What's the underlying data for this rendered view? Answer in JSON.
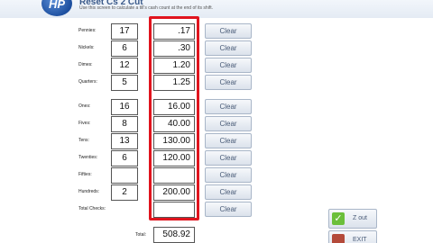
{
  "header": {
    "logo_text": "HP",
    "title": "Reset Cs 2 Cut",
    "subtitle": "Use this screen to calculate a till's cash count at the end of its shift."
  },
  "rows": [
    {
      "label": "Pennies:",
      "count": "17",
      "amount": ".17",
      "clear": "Clear"
    },
    {
      "label": "Nickels:",
      "count": "6",
      "amount": ".30",
      "clear": "Clear"
    },
    {
      "label": "Dimes:",
      "count": "12",
      "amount": "1.20",
      "clear": "Clear"
    },
    {
      "label": "Quarters:",
      "count": "5",
      "amount": "1.25",
      "clear": "Clear"
    },
    {
      "label": "Ones:",
      "count": "16",
      "amount": "16.00",
      "clear": "Clear"
    },
    {
      "label": "Fives:",
      "count": "8",
      "amount": "40.00",
      "clear": "Clear"
    },
    {
      "label": "Tens:",
      "count": "13",
      "amount": "130.00",
      "clear": "Clear"
    },
    {
      "label": "Twenties:",
      "count": "6",
      "amount": "120.00",
      "clear": "Clear"
    },
    {
      "label": "Fifties:",
      "count": "",
      "amount": "",
      "clear": "Clear"
    },
    {
      "label": "Hundreds:",
      "count": "2",
      "amount": "200.00",
      "clear": "Clear"
    },
    {
      "label": "Total Checks:",
      "amount": "",
      "clear": "Clear"
    }
  ],
  "total": {
    "label": "Total:",
    "value": "508.92"
  },
  "actions": {
    "zout_label": "Z out",
    "exit_label": "EXIT"
  },
  "colors": {
    "highlight_frame": "#e0141e",
    "button_text": "#4a5c78"
  }
}
